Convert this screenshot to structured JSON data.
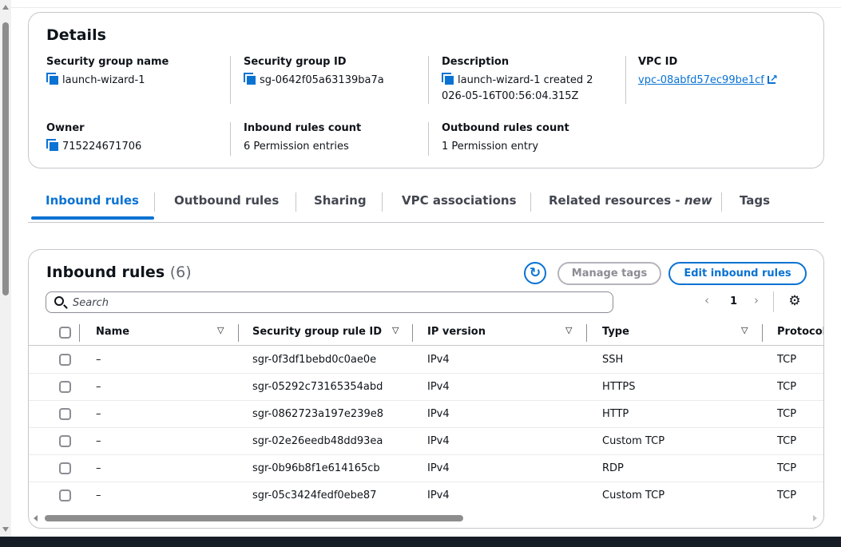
{
  "details": {
    "title": "Details",
    "security_group_name": {
      "label": "Security group name",
      "value": "launch-wizard-1"
    },
    "security_group_id": {
      "label": "Security group ID",
      "value": "sg-0642f05a63139ba7a"
    },
    "description": {
      "label": "Description",
      "value_line1": "launch-wizard-1 created 2",
      "value_line2": "026-05-16T00:56:04.315Z"
    },
    "vpc_id": {
      "label": "VPC ID",
      "value": "vpc-08abfd57ec99be1cf"
    },
    "owner": {
      "label": "Owner",
      "value": "715224671706"
    },
    "inbound_rules_count": {
      "label": "Inbound rules count",
      "value": "6 Permission entries"
    },
    "outbound_rules_count": {
      "label": "Outbound rules count",
      "value": "1 Permission entry"
    }
  },
  "tabs": [
    {
      "label": "Inbound rules",
      "active": true
    },
    {
      "label": "Outbound rules"
    },
    {
      "label": "Sharing"
    },
    {
      "label": "VPC associations"
    },
    {
      "label": "Related resources - ",
      "suffix": "new"
    },
    {
      "label": "Tags"
    }
  ],
  "rules": {
    "title": "Inbound rules",
    "count": "(6)",
    "manage_tags_label": "Manage tags",
    "edit_label": "Edit inbound rules",
    "search_placeholder": "Search",
    "page": "1",
    "columns": [
      "Name",
      "Security group rule ID",
      "IP version",
      "Type",
      "Protocol"
    ],
    "rows": [
      {
        "name": "–",
        "rule_id": "sgr-0f3df1bebd0c0ae0e",
        "ip_version": "IPv4",
        "type": "SSH",
        "protocol": "TCP"
      },
      {
        "name": "–",
        "rule_id": "sgr-05292c73165354abd",
        "ip_version": "IPv4",
        "type": "HTTPS",
        "protocol": "TCP"
      },
      {
        "name": "–",
        "rule_id": "sgr-0862723a197e239e8",
        "ip_version": "IPv4",
        "type": "HTTP",
        "protocol": "TCP"
      },
      {
        "name": "–",
        "rule_id": "sgr-02e26eedb48dd93ea",
        "ip_version": "IPv4",
        "type": "Custom TCP",
        "protocol": "TCP"
      },
      {
        "name": "–",
        "rule_id": "sgr-0b96b8f1e614165cb",
        "ip_version": "IPv4",
        "type": "RDP",
        "protocol": "TCP"
      },
      {
        "name": "–",
        "rule_id": "sgr-05c3424fedf0ebe87",
        "ip_version": "IPv4",
        "type": "Custom TCP",
        "protocol": "TCP"
      }
    ]
  },
  "colors": {
    "accent": "#0972d3",
    "text": "#0f141a",
    "border": "#c6c6cd",
    "footer": "#161d26"
  }
}
